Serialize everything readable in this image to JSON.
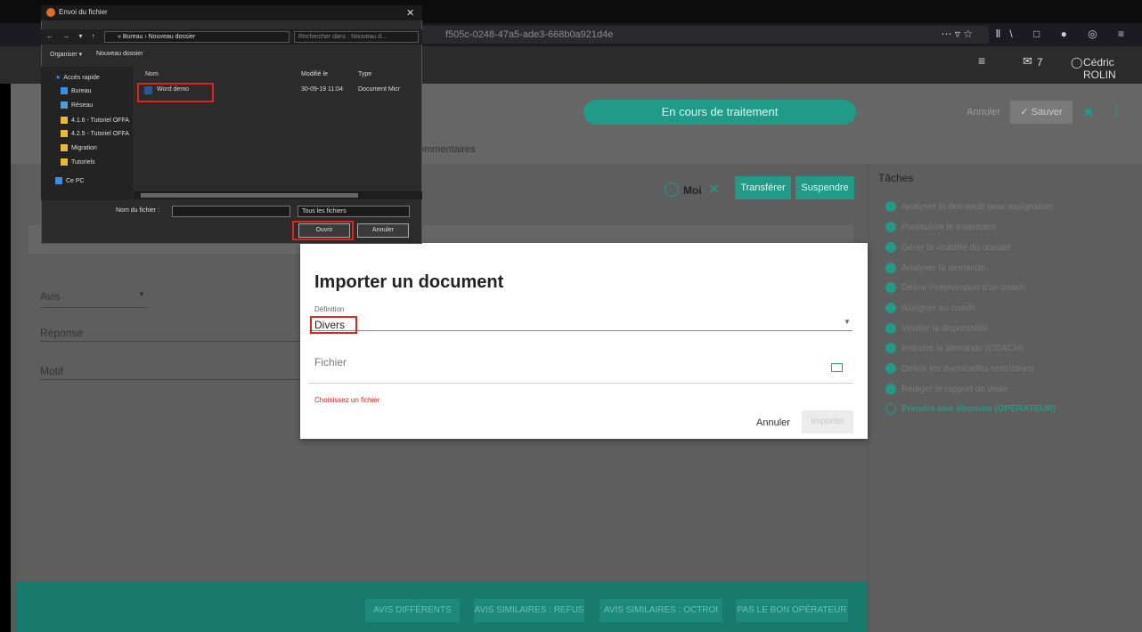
{
  "browser": {
    "url_fragment": "f505c-0248-47a5-ade3-668b0a921d4e",
    "url_actions": "⋯ ▿ ☆",
    "right_icons": "Ⅱ\\ □ ● ◎ ≡"
  },
  "header": {
    "menu_icon": "≡",
    "mail_icon": "✉",
    "mail_count": "7",
    "user_icon": "◯",
    "user_name": "Cédric ROLIN"
  },
  "page": {
    "status": "En cours de traitement",
    "cancel_label": "Annuler",
    "save_label": "✓ Sauver",
    "tab_comments": "ommentaires",
    "assignee": "Moi",
    "transfer_label": "Transférer",
    "suspend_label": "Suspendre",
    "fields": {
      "avis": "Avis",
      "reponse": "Réponse",
      "motif": "Motif"
    },
    "footer_buttons": [
      "AVIS DIFFÉRENTS",
      "AVIS SIMILAIRES : REFUS",
      "AVIS SIMILAIRES : OCTROI",
      "PAS LE BON OPÉRATEUR"
    ]
  },
  "tasks": {
    "title": "Tâches",
    "items": [
      "Analyser la demande pour assignation",
      "Poursuivre le traitement",
      "Gérer la visibilité du dossier",
      "Analyser la demande",
      "Définir l'intervention d'un coach",
      "Assigner au coach",
      "Vérifier la disponibilité",
      "Instruire la demande (COACH)",
      "Définir les éventuelles restrictions",
      "Rédiger le rapport de visite",
      "Prendre une décision (OPÉRATEUR)"
    ]
  },
  "import_dialog": {
    "title": "Importer un document",
    "definition_label": "Définition",
    "definition_value": "Divers",
    "file_label": "Fichier",
    "error": "Choisissez un fichier",
    "cancel_label": "Annuler",
    "import_label": "Importer"
  },
  "file_dialog": {
    "title": "Envoi du fichier",
    "path": "« Bureau › Nouveau dossier",
    "search_placeholder": "Rechercher dans : Nouveau d...",
    "organize_label": "Organiser ▾",
    "new_folder_label": "Nouveau dossier",
    "nav": [
      "Accès rapide",
      "Bureau",
      "Réseau",
      "4.1.6 - Tutoriel OFFA",
      "4.2.5 - Tutoriel OFFA",
      "Migration",
      "Tutoriels",
      "Ce PC"
    ],
    "columns": {
      "name": "Nom",
      "modified": "Modifié le",
      "type": "Type"
    },
    "file": {
      "name": "Word demo",
      "modified": "30-09-19 11:04",
      "type": "Document Micr"
    },
    "filename_label": "Nom du fichier :",
    "filetype": "Tous les fichiers",
    "open_label": "Ouvrir",
    "cancel_label": "Annuler"
  }
}
